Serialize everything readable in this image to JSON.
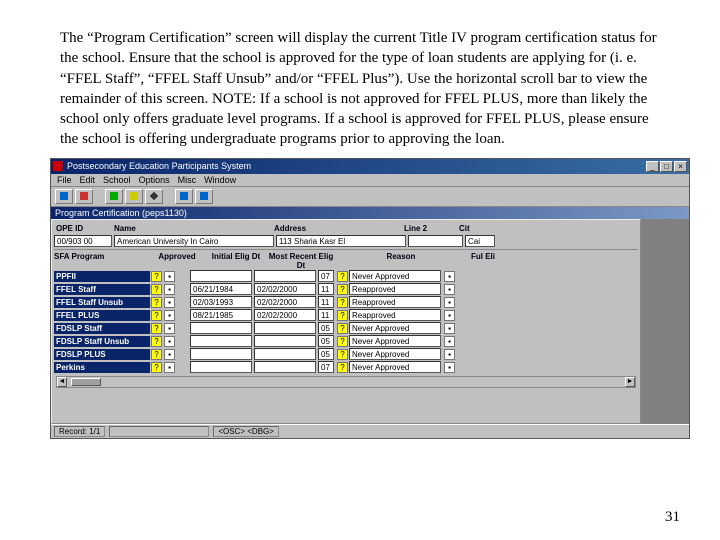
{
  "paragraph": "The “Program Certification” screen will display the current Title IV program certification status for the school. Ensure that the school is approved for the type of loan students are applying for (i. e. “FFEL Staff”, “FFEL Staff Unsub” and/or “FFEL Plus”). Use the horizontal scroll bar to view the remainder of this screen. NOTE:  If a school is not approved for FFEL PLUS, more than likely the school only offers graduate level programs.  If a school is approved for FFEL PLUS, please ensure the school is offering undergraduate programs prior to approving the loan.",
  "page_number": "31",
  "titlebar": {
    "title": "Postsecondary Education Participants System",
    "min": "_",
    "max": "□",
    "close": "×"
  },
  "menubar": [
    "File",
    "Edit",
    "School",
    "Options",
    "Misc",
    "Window"
  ],
  "subtitle": {
    "left": "Program Certification  (peps1130)",
    "right": ""
  },
  "top": {
    "ope_id_label": "OPE ID",
    "ope_id_value": "00/903 00",
    "name_label": "Name",
    "name_value": "American University In Cairo",
    "address_label": "Address",
    "address_value": "113 Sharia Kasr El",
    "line2_label": "Line 2",
    "line2_value": "",
    "cit_label": "Cit",
    "cit_value": "Cai"
  },
  "tbl_header": {
    "prog": "SFA Program",
    "approved": "Approved",
    "init": "Initial Elig Dt",
    "recent": "Most Recent Elig Dt",
    "reason": "Reason",
    "ful": "Ful Eli"
  },
  "rows": [
    {
      "label": "PPFII",
      "init": "",
      "recent": "",
      "num": "07",
      "reason": "Never Approved"
    },
    {
      "label": "FFEL Staff",
      "init": "06/21/1984",
      "recent": "02/02/2000",
      "num": "11",
      "reason": "Reapproved"
    },
    {
      "label": "FFEL Staff Unsub",
      "init": "02/03/1993",
      "recent": "02/02/2000",
      "num": "11",
      "reason": "Reapproved"
    },
    {
      "label": "FFEL PLUS",
      "init": "08/21/1985",
      "recent": "02/02/2000",
      "num": "11",
      "reason": "Reapproved"
    },
    {
      "label": "FDSLP Staff",
      "init": "",
      "recent": "",
      "num": "05",
      "reason": "Never Approved"
    },
    {
      "label": "FDSLP Staff Unsub",
      "init": "",
      "recent": "",
      "num": "05",
      "reason": "Never Approved"
    },
    {
      "label": "FDSLP PLUS",
      "init": "",
      "recent": "",
      "num": "05",
      "reason": "Never Approved"
    },
    {
      "label": "Perkins",
      "init": "",
      "recent": "",
      "num": "07",
      "reason": "Never Approved"
    }
  ],
  "status": {
    "left": "Record: 1/1",
    "mid": "<OSC> <DBG>"
  }
}
